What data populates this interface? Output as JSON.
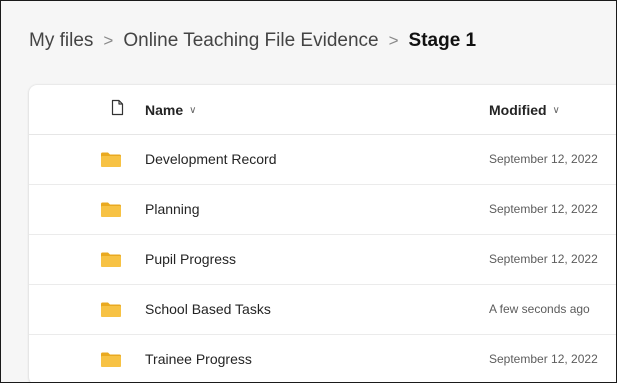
{
  "breadcrumb": {
    "items": [
      "My files",
      "Online Teaching File Evidence"
    ],
    "current": "Stage 1",
    "separator": ">"
  },
  "columns": {
    "type_icon": "file-icon",
    "name": "Name",
    "modified": "Modified"
  },
  "rows": [
    {
      "name": "Development Record",
      "modified": "September 12, 2022",
      "icon": "folder-icon"
    },
    {
      "name": "Planning",
      "modified": "September 12, 2022",
      "icon": "folder-icon"
    },
    {
      "name": "Pupil Progress",
      "modified": "September 12, 2022",
      "icon": "folder-icon"
    },
    {
      "name": "School Based Tasks",
      "modified": "A few seconds ago",
      "icon": "folder-icon"
    },
    {
      "name": "Trainee Progress",
      "modified": "September 12, 2022",
      "icon": "folder-icon"
    }
  ],
  "colors": {
    "folder": "#f7c244",
    "folder_back": "#e9a920",
    "text": "#242424",
    "muted": "#5c5c5c"
  }
}
